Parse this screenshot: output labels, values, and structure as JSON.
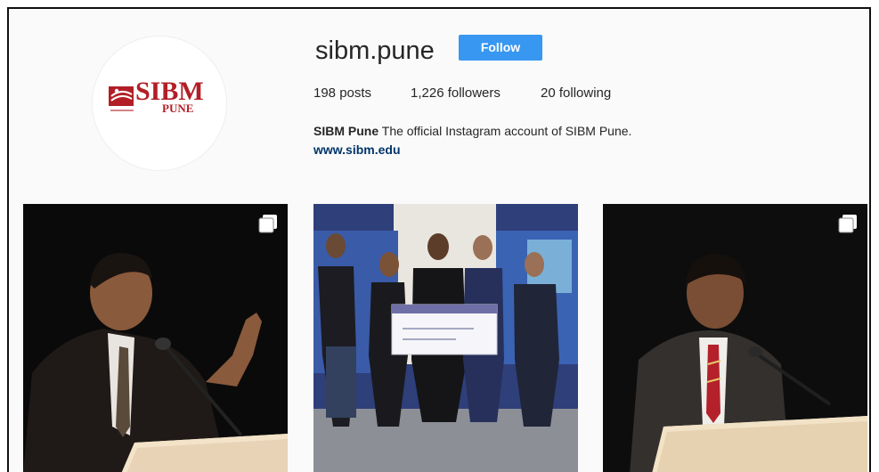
{
  "profile": {
    "username": "sibm.pune",
    "follow_label": "Follow",
    "stats": {
      "posts": "198 posts",
      "followers": "1,226 followers",
      "following": "20 following"
    },
    "bio_name": "SIBM Pune",
    "bio_text": " The official Instagram account of SIBM Pune.",
    "website": "www.sibm.edu"
  },
  "avatar": {
    "logo_word": "SIBM",
    "logo_sub": "PUNE",
    "brand_color": "#b21f27"
  },
  "posts": [
    {
      "subject": "speaker-gesturing",
      "multi_image": true,
      "icon": "multiple-images-icon"
    },
    {
      "subject": "group-holding-cheque",
      "multi_image": false,
      "icon": ""
    },
    {
      "subject": "speaker-at-podium",
      "multi_image": true,
      "icon": "multiple-images-icon"
    }
  ],
  "colors": {
    "follow_button": "#3897f0",
    "link": "#003569",
    "background": "#fafafa"
  }
}
